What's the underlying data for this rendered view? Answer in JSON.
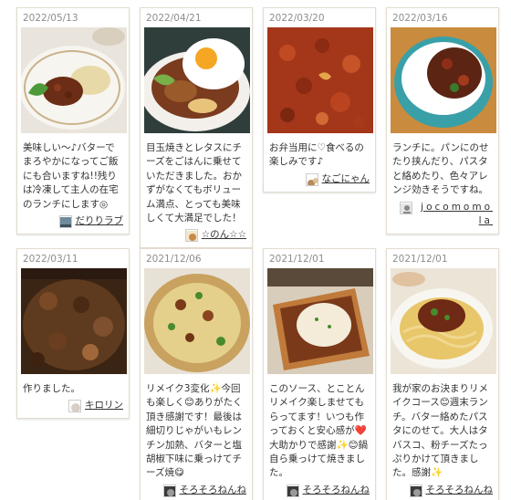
{
  "cards": [
    {
      "date": "2022/05/13",
      "text": "美味しい〜♪バターでまろやかになってご飯にも合いますね!!残りは冷凍して主人の在宅のランチにします◎",
      "user": "だりりラブ",
      "photo": "curry-plate-with-rice"
    },
    {
      "date": "2022/04/21",
      "text": "目玉焼きとレタスにチーズをごはんに乗せていただきました。おかずがなくてもボリューム満点、とっても美味しくて大満足でした！",
      "user": "☆のん☆☆",
      "photo": "loco-moco-bowl-with-egg"
    },
    {
      "date": "2022/03/20",
      "text": "お弁当用に♡食べるの楽しみです♪",
      "user": "なごにゃん",
      "photo": "meat-sauce-closeup"
    },
    {
      "date": "2022/03/16",
      "text": "ランチに。パンにのせたり挟んだり、パスタと絡めたり、色々アレンジ効きそうですね。",
      "user": "jocomomola",
      "photo": "rice-bowl-with-sauce"
    },
    {
      "date": "2022/03/11",
      "text": "作りました。",
      "user": "キロリン",
      "photo": "meat-sauce-pan"
    },
    {
      "date": "2021/12/06",
      "text": "リメイク3変化✨今回も楽しく😊ありがたく頂き感謝です！最後は細切りじゃがいもレンチン加熱、バターと塩胡椒下味に乗っけてチーズ焼😋",
      "user": "そろそろねんね",
      "photo": "potato-cheese-gratin"
    },
    {
      "date": "2021/12/01",
      "text": "このソース、とことんリメイク楽しませてもらってます！いつも作っておくと安心感が❤️大助かりで感謝✨😊鍋自ら乗っけて焼きました。",
      "user": "そろそろねんね",
      "photo": "pizza-toast"
    },
    {
      "date": "2021/12/01",
      "text": "我が家のお決まりリメイクコース😊週末ランチ。バター絡めたパスタにのせて。大人はタバスコ、粉チーズたっぷりかけて頂きました。感謝✨",
      "user": "そろそろねんね",
      "photo": "spaghetti-with-meat-sauce"
    }
  ],
  "colors": {
    "card_border": "#e3dcd0",
    "date_text": "#8d8d8d",
    "body_text": "#333333"
  }
}
